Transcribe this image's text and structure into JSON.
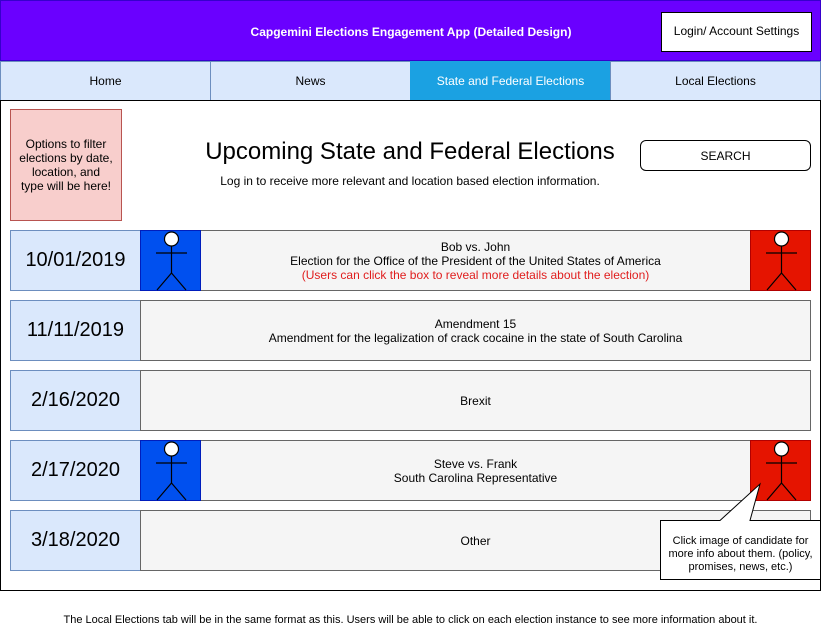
{
  "header": {
    "title": "Capgemini Elections Engagement App (Detailed Design)",
    "login_label": "Login/ Account Settings"
  },
  "nav": {
    "tabs": [
      {
        "label": "Home",
        "active": false
      },
      {
        "label": "News",
        "active": false
      },
      {
        "label": "State and Federal Elections",
        "active": true
      },
      {
        "label": "Local Elections",
        "active": false
      }
    ]
  },
  "filter_note": "Options to filter elections by date, location, and type will be here!",
  "main": {
    "title": "Upcoming State and Federal Elections",
    "subtitle": "Log in to receive more relevant and location based election information.",
    "search_label": "SEARCH"
  },
  "elections": [
    {
      "date": "10/01/2019",
      "line1": "Bob vs. John",
      "line2": "Election for the Office of the President of the United States of America",
      "note": "(Users can click the box to reveal more details about the election)",
      "has_candidates": true
    },
    {
      "date": "11/11/2019",
      "line1": "Amendment 15",
      "line2": "Amendment for the legalization of crack cocaine in the state of South Carolina",
      "note": "",
      "has_candidates": false
    },
    {
      "date": "2/16/2020",
      "line1": "Brexit",
      "line2": "",
      "note": "",
      "has_candidates": false
    },
    {
      "date": "2/17/2020",
      "line1": "Steve vs. Frank",
      "line2": "South Carolina Representative",
      "note": "",
      "has_candidates": true
    },
    {
      "date": "3/18/2020",
      "line1": "Other",
      "line2": "",
      "note": "",
      "has_candidates": false
    }
  ],
  "callout": {
    "text": "Click image of candidate for more info about them. (policy, promises, news, etc.)"
  },
  "footer_note": "The Local Elections tab will be in the same format as this. Users will be able to click on each election instance to see more information about it.",
  "colors": {
    "header": "#6a00ff",
    "nav_tab": "#dae8fc",
    "nav_active": "#1ba1e2",
    "filter_box": "#f8cecc",
    "candidate_blue": "#0050ef",
    "candidate_red": "#e51400",
    "note_text": "#e01d1d"
  }
}
